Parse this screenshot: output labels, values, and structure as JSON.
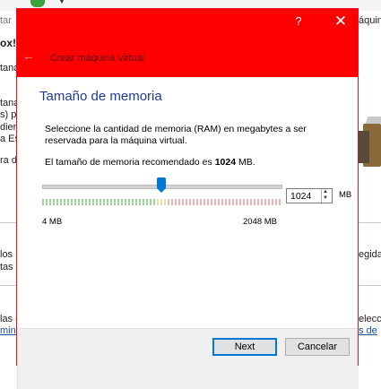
{
  "background": {
    "left_fragments": [
      "tar",
      "ox!",
      "tana",
      "tana",
      "s) p",
      "dien",
      "a Es",
      "ra d",
      "los",
      "tas p",
      "las i",
      "mina"
    ],
    "right_fragments": [
      "áquina",
      "egida",
      "elecc",
      "s de"
    ]
  },
  "dialog": {
    "help_label": "?",
    "close_label": "✕",
    "wizard_title": "Crear máquina virtual",
    "back_label": "←",
    "page_title": "Tamaño de memoria",
    "description": "Seleccione la cantidad de memoria (RAM) en megabytes a ser reservada para la máquina virtual.",
    "recommend_prefix": "El tamaño de memoria recomendado es ",
    "recommend_value": "1024",
    "recommend_suffix": " MB.",
    "slider": {
      "min_label": "4 MB",
      "max_label": "2048 MB",
      "min": 4,
      "max": 2048,
      "value": 1024
    },
    "spin_value": "1024",
    "spin_up": "▲",
    "spin_down": "▼",
    "unit": "MB",
    "next_label": "Next",
    "cancel_label": "Cancelar"
  },
  "colors": {
    "accent": "#ff0000",
    "title_text": "#1f3a93",
    "slider_thumb": "#0078d7",
    "tick_safe": "#9bd49b",
    "tick_warn": "#f3b4b4"
  }
}
